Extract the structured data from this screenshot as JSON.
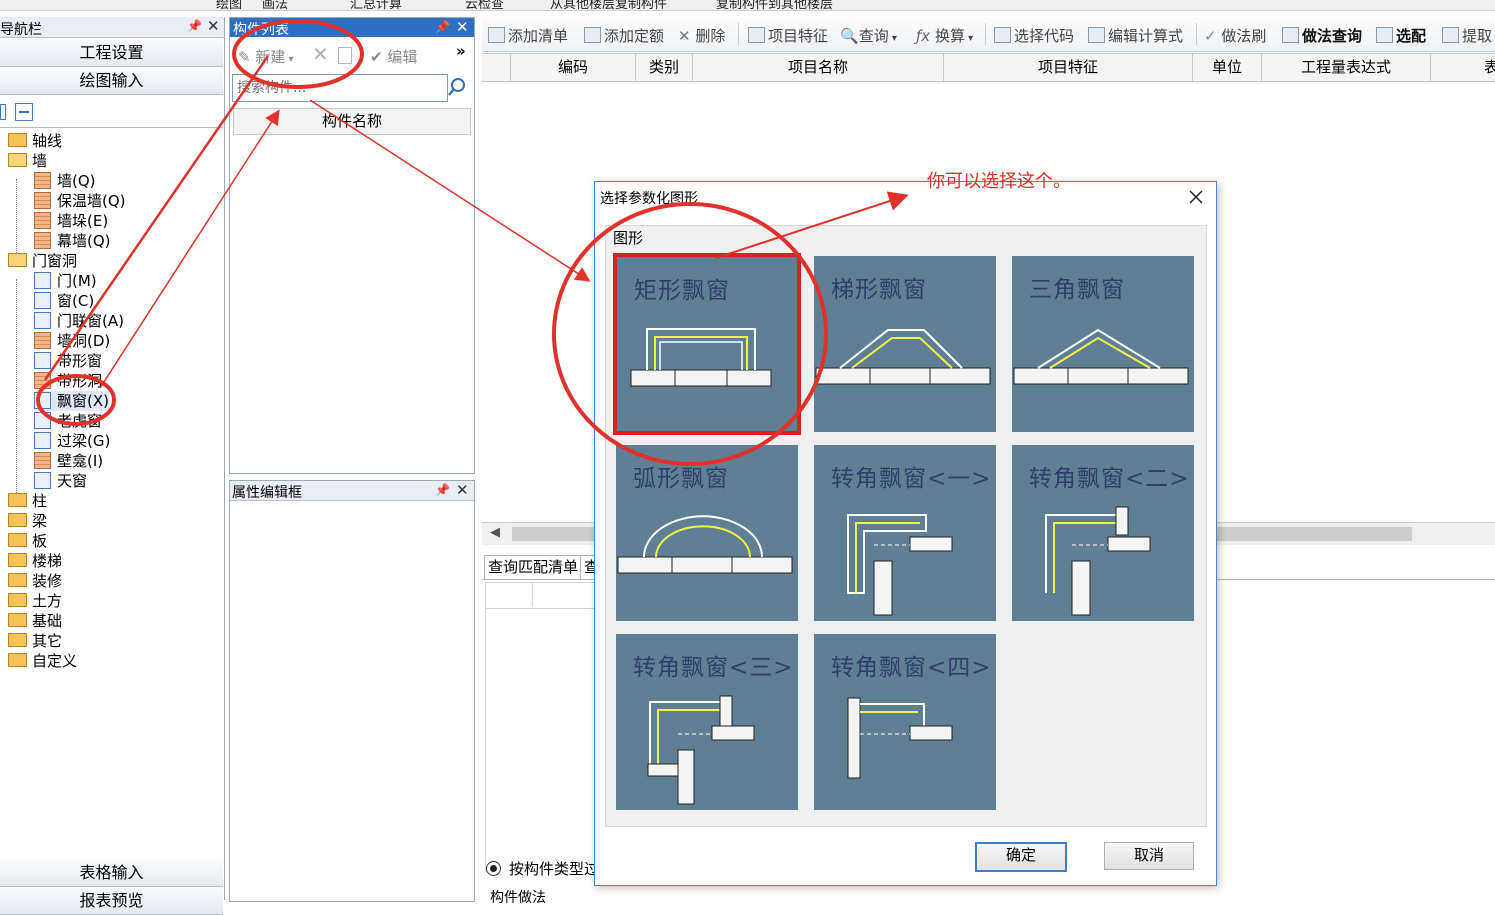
{
  "top_strip": {
    "items": [
      "绘图",
      "画法",
      "汇总计算",
      "云检查",
      "从其他楼层复制构件",
      "复制构件到其他楼层"
    ]
  },
  "nav": {
    "title": "导航栏",
    "buttons": {
      "project_settings": "工程设置",
      "drawing_input": "绘图输入",
      "table_input": "表格输入",
      "report_preview": "报表预览"
    },
    "tree": [
      {
        "label": "轴线",
        "type": "folder"
      },
      {
        "label": "墙",
        "type": "folder-open"
      },
      {
        "label": "墙(Q)",
        "type": "wall"
      },
      {
        "label": "保温墙(Q)",
        "type": "wall"
      },
      {
        "label": "墙垛(E)",
        "type": "wall"
      },
      {
        "label": "幕墙(Q)",
        "type": "wall"
      },
      {
        "label": "门窗洞",
        "type": "folder-open"
      },
      {
        "label": "门(M)",
        "type": "leaf"
      },
      {
        "label": "窗(C)",
        "type": "leaf"
      },
      {
        "label": "门联窗(A)",
        "type": "leaf"
      },
      {
        "label": "墙洞(D)",
        "type": "leaf"
      },
      {
        "label": "带形窗",
        "type": "leaf"
      },
      {
        "label": "带形洞",
        "type": "leaf"
      },
      {
        "label": "飘窗(X)",
        "type": "leaf"
      },
      {
        "label": "老虎窗",
        "type": "leaf"
      },
      {
        "label": "过梁(G)",
        "type": "leaf"
      },
      {
        "label": "壁龛(I)",
        "type": "leaf"
      },
      {
        "label": "天窗",
        "type": "leaf"
      },
      {
        "label": "柱",
        "type": "folder"
      },
      {
        "label": "梁",
        "type": "folder"
      },
      {
        "label": "板",
        "type": "folder"
      },
      {
        "label": "楼梯",
        "type": "folder"
      },
      {
        "label": "装修",
        "type": "folder"
      },
      {
        "label": "土方",
        "type": "folder"
      },
      {
        "label": "基础",
        "type": "folder"
      },
      {
        "label": "其它",
        "type": "folder"
      },
      {
        "label": "自定义",
        "type": "folder"
      }
    ]
  },
  "component_list": {
    "title": "构件列表",
    "new_label": "新建",
    "edit_label": "编辑",
    "more": "»",
    "search_placeholder": "搜索构件...",
    "column_header": "构件名称"
  },
  "property_panel": {
    "title": "属性编辑框"
  },
  "toolbar": {
    "add_list": "添加清单",
    "add_quota": "添加定额",
    "delete": "删除",
    "item_feature": "项目特征",
    "query": "查询",
    "convert": "换算",
    "select_code": "选择代码",
    "edit_formula": "编辑计算式",
    "method_brush": "做法刷",
    "method_query": "做法查询",
    "match": "选配",
    "extract": "提取"
  },
  "grid_headers": [
    "编码",
    "类别",
    "项目名称",
    "项目特征",
    "单位",
    "工程量表达式",
    "表"
  ],
  "lower": {
    "tab1": "查询匹配清单",
    "tab2": "查",
    "radio_label": "按构件类型过",
    "bottom_tab": "构件做法"
  },
  "dialog": {
    "title": "选择参数化图形",
    "group_label": "图形",
    "shapes": [
      "矩形飘窗",
      "梯形飘窗",
      "三角飘窗",
      "弧形飘窗",
      "转角飘窗<一>",
      "转角飘窗<二>",
      "转角飘窗<三>",
      "转角飘窗<四>"
    ],
    "selected_index": 0,
    "ok": "确定",
    "cancel": "取消"
  },
  "annotation": {
    "text": "你可以选择这个。",
    "color": "#e0312a"
  },
  "colors": {
    "panel_title_active": "#2d6fc2",
    "shape_bg": "#5f7f95",
    "highlight_red": "#e02020"
  }
}
